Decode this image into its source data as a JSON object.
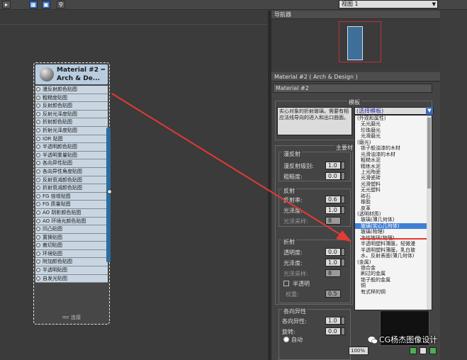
{
  "toolbar": {
    "buttons": [
      "",
      "",
      "",
      ""
    ],
    "view_select": "视图 1"
  },
  "node": {
    "title_line1": "Material #2",
    "title_line2": "Arch & De...",
    "minimize": "━",
    "slots": [
      "漫反射颜色贴图",
      "粗糙度贴图",
      "反射颜色贴图",
      "反射光泽度贴图",
      "折射颜色贴图",
      "折射光泽度贴图",
      "IOR 贴图",
      "半透明颜色贴图",
      "半透明重量贴图",
      "各向异性贴图",
      "各向异性角度贴图",
      "反射衰减颜色贴图",
      "折射衰减颜色贴图",
      "FG 倍增贴图",
      "FG 质量贴图",
      "AO 阴影颜色贴图",
      "AO 环境光颜色贴图",
      "凹凸贴图",
      "置换贴图",
      "裁切贴图",
      "环境贴图",
      "附加颜色贴图",
      "半透明贴图",
      "自发光贴图"
    ],
    "footer": "mr 连接"
  },
  "navigator": {
    "title": "导航器"
  },
  "material_panel": {
    "header": "Material #2 ( Arch & Design )",
    "name_field": "Material #2",
    "template_label": "模板",
    "template_description": "实心对象的折射玻璃，需要有相应法线导向的进入和出口曲面。",
    "template_select": "(选择模板)",
    "main_params_label": "主要材",
    "diffuse_label": "漫反射",
    "diffuse_level_label": "漫反射级别:",
    "diffuse_level_value": "1.0",
    "roughness_label": "粗糙度:",
    "roughness_value": "0.0",
    "reflection_label": "反射",
    "reflectivity_label": "反射率:",
    "reflectivity_value": "0.6",
    "glossiness_label": "光泽度:",
    "glossiness_value": "1.0",
    "gloss_samples_label": "光泽采样:",
    "gloss_samples_value": "8",
    "refraction_label": "折射",
    "transparency_label": "透明度:",
    "transparency_value": "0.0",
    "refr_gloss_label": "光泽度:",
    "refr_gloss_value": "1.0",
    "refr_samples_label": "光泽采样:",
    "refr_samples_value": "8",
    "translucency_label": "半透明",
    "weight_label": "权重:",
    "weight_value": "0.5",
    "anisotropy_label": "各向异性",
    "aniso_label": "各向异性:",
    "aniso_value": "1.0",
    "rotation_label": "旋转:",
    "rotation_value": "0.0",
    "auto_label": "自动"
  },
  "dropdown": {
    "items": [
      {
        "text": "(外观和属性)",
        "sub": false
      },
      {
        "text": "无光磨光",
        "sub": true
      },
      {
        "text": "珍珠磨光",
        "sub": true
      },
      {
        "text": "光滑磨光",
        "sub": true
      },
      {
        "text": "(磨光)",
        "sub": false
      },
      {
        "text": "锁子般油漆的木材",
        "sub": true
      },
      {
        "text": "光滑油漆的木材",
        "sub": true
      },
      {
        "text": "粗糙水泥",
        "sub": true
      },
      {
        "text": "精练水泥",
        "sub": true
      },
      {
        "text": "上光陶瓷",
        "sub": true
      },
      {
        "text": "光滑瓷砖",
        "sub": true
      },
      {
        "text": "光滑塑料",
        "sub": true
      },
      {
        "text": "无光塑料",
        "sub": true
      },
      {
        "text": "砖石",
        "sub": true
      },
      {
        "text": "橡胶",
        "sub": true
      },
      {
        "text": "皮革",
        "sub": true
      },
      {
        "text": "(透明材质)",
        "sub": false
      },
      {
        "text": "玻璃(薄几何体)",
        "sub": true
      },
      {
        "text": "玻璃(实心几何体)",
        "sub": true
      },
      {
        "text": "玻璃(物理)",
        "sub": true
      },
      {
        "text": "冻结玻璃(物理)",
        "sub": true
      },
      {
        "text": "半透明塑料薄膜，轻微漫",
        "sub": true
      },
      {
        "text": "半透明塑料薄膜，乳白玻",
        "sub": true
      },
      {
        "text": "水，反射表面(薄几何体)",
        "sub": true
      },
      {
        "text": "(金属)",
        "sub": false
      },
      {
        "text": "铬合金",
        "sub": true
      },
      {
        "text": "刷过的金属",
        "sub": true
      },
      {
        "text": "锁子般的金属",
        "sub": true
      },
      {
        "text": "铜",
        "sub": true
      },
      {
        "text": "有式样的铜",
        "sub": true
      }
    ],
    "selected_index": 18
  },
  "bottom": {
    "zoom": "100%",
    "watermark": "CG杨杰图像设计"
  },
  "colors": {
    "arrow": "#e53935",
    "selection": "#3f7fd6",
    "node_slot": "#c9d6e2"
  }
}
